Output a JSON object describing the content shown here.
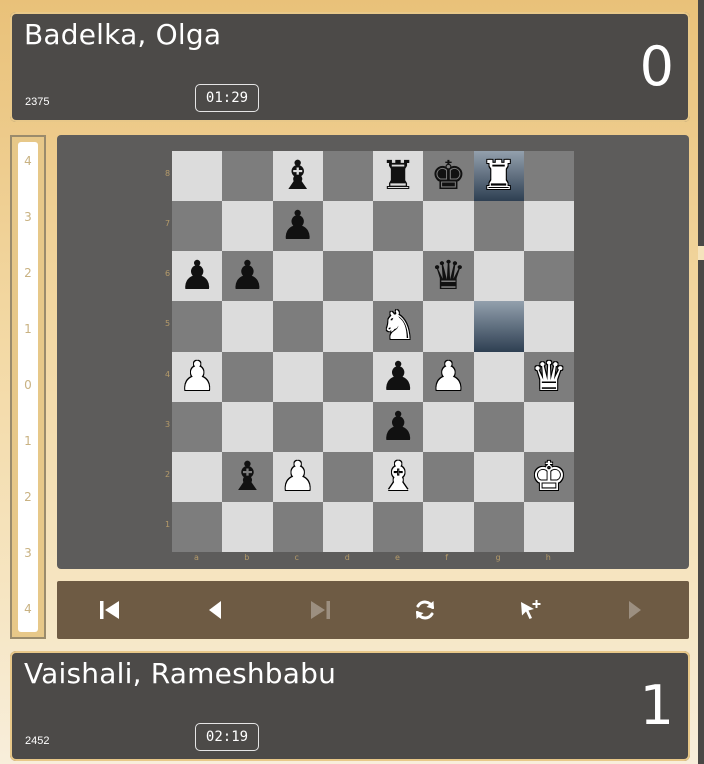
{
  "top_player": {
    "name": "Badelka, Olga",
    "rating": "2375",
    "clock": "01:29",
    "score": "0"
  },
  "bottom_player": {
    "name": "Vaishali, Rameshbabu",
    "rating": "2452",
    "clock": "02:19",
    "score": "1"
  },
  "eval_bar": {
    "labels": [
      "4",
      "3",
      "2",
      "1",
      "0",
      "1",
      "2",
      "3",
      "4"
    ]
  },
  "board": {
    "ranks": [
      "8",
      "7",
      "6",
      "5",
      "4",
      "3",
      "2",
      "1"
    ],
    "files": [
      "a",
      "b",
      "c",
      "d",
      "e",
      "f",
      "g",
      "h"
    ],
    "highlight_squares": [
      "g8",
      "g5"
    ],
    "pieces": [
      {
        "square": "c8",
        "glyph": "♝",
        "color": "b"
      },
      {
        "square": "e8",
        "glyph": "♜",
        "color": "b"
      },
      {
        "square": "f8",
        "glyph": "♚",
        "color": "b"
      },
      {
        "square": "g8",
        "glyph": "♜",
        "color": "w"
      },
      {
        "square": "c7",
        "glyph": "♟",
        "color": "b"
      },
      {
        "square": "a6",
        "glyph": "♟",
        "color": "b"
      },
      {
        "square": "b6",
        "glyph": "♟",
        "color": "b"
      },
      {
        "square": "f6",
        "glyph": "♛",
        "color": "b"
      },
      {
        "square": "e5",
        "glyph": "♞",
        "color": "w"
      },
      {
        "square": "a4",
        "glyph": "♟",
        "color": "w"
      },
      {
        "square": "e4",
        "glyph": "♟",
        "color": "b"
      },
      {
        "square": "f4",
        "glyph": "♟",
        "color": "w"
      },
      {
        "square": "h4",
        "glyph": "♛",
        "color": "w"
      },
      {
        "square": "e3",
        "glyph": "♟",
        "color": "b"
      },
      {
        "square": "b2",
        "glyph": "♝",
        "color": "b"
      },
      {
        "square": "c2",
        "glyph": "♟",
        "color": "w"
      },
      {
        "square": "e2",
        "glyph": "♝",
        "color": "w"
      },
      {
        "square": "h2",
        "glyph": "♚",
        "color": "w"
      }
    ]
  },
  "controls": [
    {
      "name": "first-move-button",
      "icon": "skip-back-icon",
      "enabled": true
    },
    {
      "name": "previous-move-button",
      "icon": "caret-left-icon",
      "enabled": true
    },
    {
      "name": "last-move-button",
      "icon": "skip-forward-icon",
      "enabled": false
    },
    {
      "name": "flip-board-button",
      "icon": "refresh-icon",
      "enabled": true
    },
    {
      "name": "analysis-mode-button",
      "icon": "cursor-plus-icon",
      "enabled": true
    },
    {
      "name": "next-move-button",
      "icon": "caret-right-icon",
      "enabled": false
    }
  ],
  "colors": {
    "light_square": "#dcdcdc",
    "dark_square": "#7d7d7d",
    "panel": "#4c4a48",
    "controls_bg": "#6e5b44"
  }
}
